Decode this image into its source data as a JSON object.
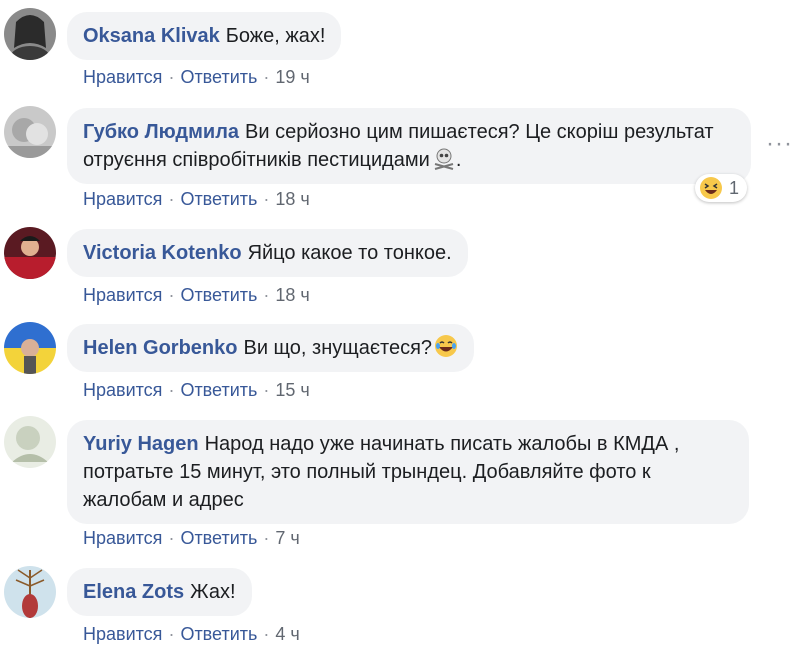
{
  "actions": {
    "like": "Нравится",
    "reply": "Ответить"
  },
  "comments": [
    {
      "author": "Oksana Klivak",
      "text": "Боже, жах!",
      "time": "19 ч"
    },
    {
      "author": "Губко Людмила",
      "text": "Ви серйозно цим пишаєтеся? Це скоріш результат отруєння співробітників пестицидами",
      "text_end": ".",
      "time": "18 ч",
      "reaction_count": "1"
    },
    {
      "author": "Victoria Kotenko",
      "text": "Яйцо какое то тонкое.",
      "time": "18 ч"
    },
    {
      "author": "Helen Gorbenko",
      "text": "Ви що, знущаєтеся?",
      "time": "15 ч"
    },
    {
      "author": "Yuriy Hagen",
      "text": "Народ надо уже начинать писать жалобы в КМДА , потратьте 15 минут, это полный трындец. Добавляйте фото к жалобам и адрес",
      "time": "7 ч"
    },
    {
      "author": "Elena Zots",
      "text": "Жах!",
      "time": "4 ч"
    }
  ],
  "colors": {
    "link": "#385898",
    "bubble": "#f2f3f5",
    "time": "#616770"
  },
  "icons": {
    "reaction": "laughing-emoji-icon",
    "more": "more-options-icon",
    "inline_skull": "skull-crossbones-icon",
    "inline_laugh": "laughing-emoji-icon"
  }
}
